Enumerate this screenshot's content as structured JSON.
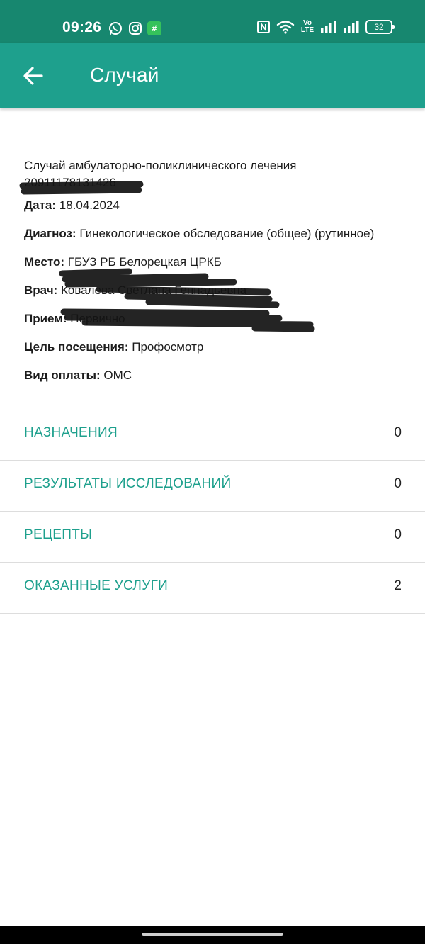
{
  "status_bar": {
    "time": "09:26",
    "left_icons": [
      "whatsapp-icon",
      "instagram-icon",
      "app-notification-icon"
    ],
    "app_badge_glyph": "#",
    "right_icons": [
      "nfc-icon",
      "wifi-icon",
      "volte-icon",
      "signal-icon",
      "signal-icon",
      "battery-icon"
    ],
    "volte_label": "Vo LTE",
    "battery": "32"
  },
  "header": {
    "title": "Случай",
    "back_icon": "arrow-left-icon"
  },
  "case": {
    "title": "Случай амбулаторно-поликлинического лечения",
    "number": "20911178131426",
    "fields": [
      {
        "label": "Дата:",
        "value": "18.04.2024"
      },
      {
        "label": "Диагноз:",
        "value": "Гинекологическое обследование (общее) (рутинное)"
      },
      {
        "label": "Место:",
        "value": "ГБУЗ РБ Белорецкая ЦРКБ"
      },
      {
        "label": "Врач:",
        "value": "Ковалева Светлана Геннадьевна"
      },
      {
        "label": "Прием:",
        "value": "Первично"
      },
      {
        "label": "Цель посещения:",
        "value": "Профосмотр"
      },
      {
        "label": "Вид оплаты:",
        "value": "ОМС"
      }
    ]
  },
  "sections": [
    {
      "label": "НАЗНАЧЕНИЯ",
      "count": "0"
    },
    {
      "label": "РЕЗУЛЬТАТЫ ИССЛЕДОВАНИЙ",
      "count": "0"
    },
    {
      "label": "РЕЦЕПТЫ",
      "count": "0"
    },
    {
      "label": "ОКАЗАННЫЕ УСЛУГИ",
      "count": "2"
    }
  ],
  "colors": {
    "status_bar": "#17876f",
    "app_bar": "#1ea08d",
    "accent_text": "#1ea08d",
    "divider": "#dddddd"
  }
}
